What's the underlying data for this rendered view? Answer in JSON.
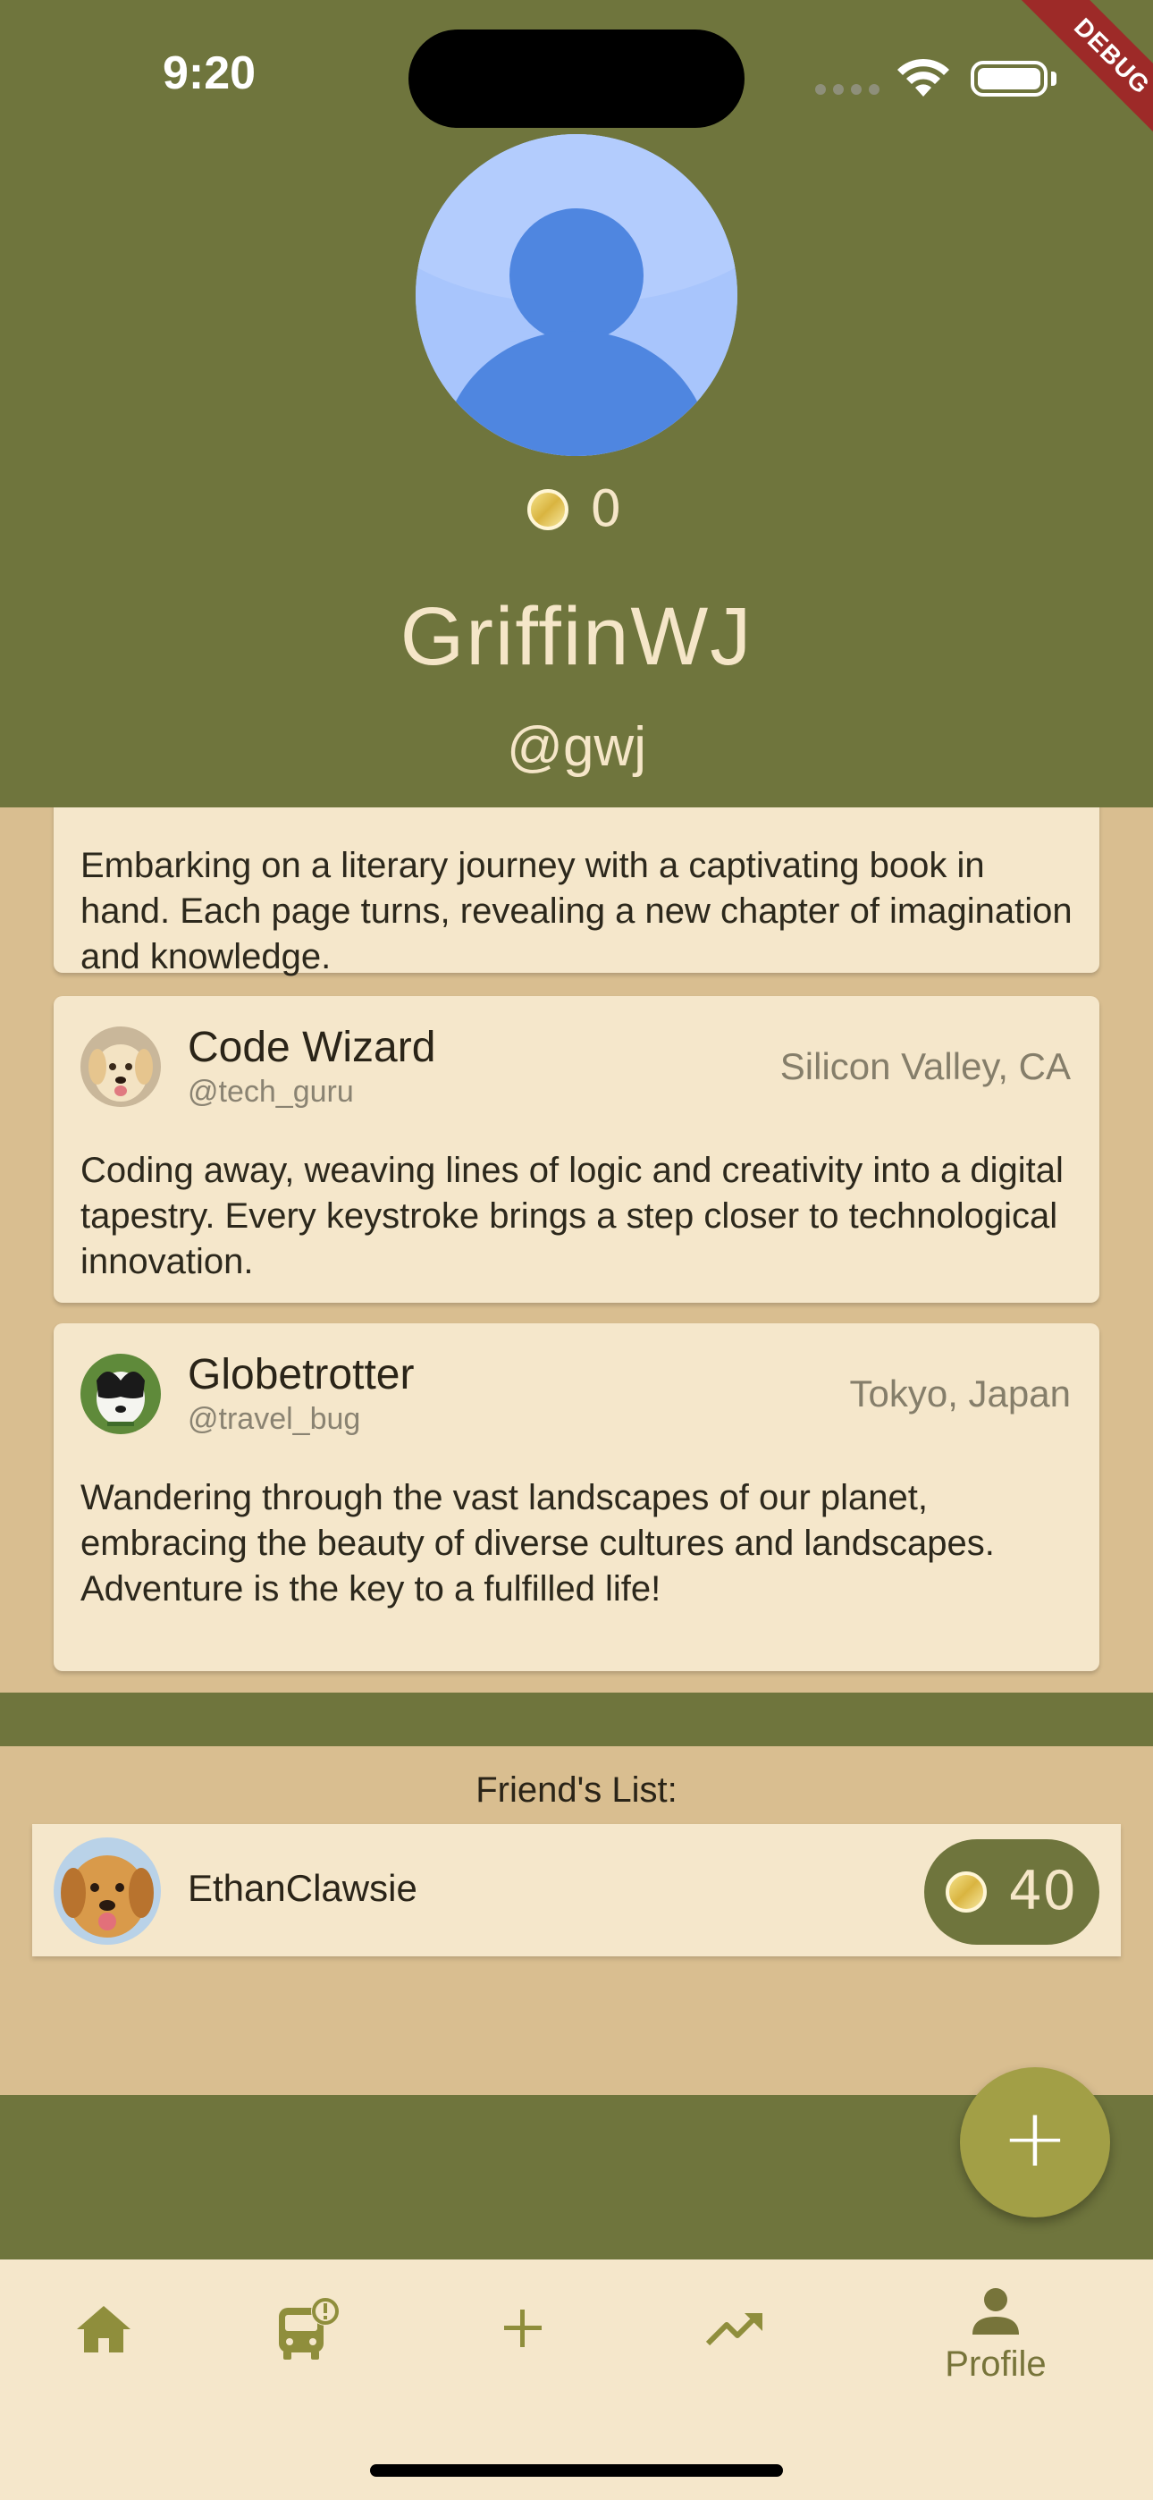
{
  "status_bar": {
    "time": "9:20"
  },
  "debug_banner": "DEBUG",
  "profile": {
    "coins": "0",
    "username": "GriffinWJ",
    "handle": "@gwj"
  },
  "posts": [
    {
      "text": "Embarking on a literary journey with a captivating book in hand. Each page turns, revealing a new chapter of imagination and knowledge."
    },
    {
      "name": "Code Wizard",
      "handle": "@tech_guru",
      "location": "Silicon Valley, CA",
      "text": "Coding away, weaving lines of logic and creativity into a digital tapestry. Every keystroke brings a step closer to technological innovation."
    },
    {
      "name": "Globetrotter",
      "handle": "@travel_bug",
      "location": "Tokyo, Japan",
      "text": "Wandering through the vast landscapes of our planet, embracing the beauty of diverse cultures and landscapes. Adventure is the key to a fulfilled life!"
    }
  ],
  "friends": {
    "title": "Friend's List:",
    "items": [
      {
        "name": "EthanClawsie",
        "coins": "40"
      }
    ]
  },
  "fab": {
    "icon": "plus-icon",
    "glyph": "+"
  },
  "bottom_nav": {
    "items": [
      {
        "icon": "home-icon"
      },
      {
        "icon": "bus-alert-icon"
      },
      {
        "icon": "add-icon"
      },
      {
        "icon": "trending-up-icon"
      },
      {
        "icon": "person-icon",
        "label": "Profile"
      }
    ]
  },
  "colors": {
    "header_bg": "#6f753d",
    "content_bg": "#d9be90",
    "card_bg": "#f5e7cb",
    "accent": "#a29f46",
    "text_light": "#f5e6c8"
  }
}
